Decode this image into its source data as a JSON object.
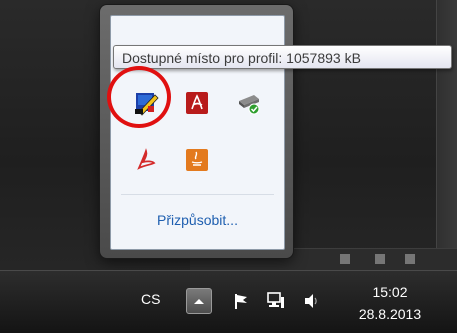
{
  "tooltip": {
    "text": "Dostupné místo pro profil:  1057893 kB"
  },
  "tray_popup": {
    "icons": [
      "drawing-tool-icon",
      "adobe-acrobat-icon",
      "network-drive-icon",
      "acrobat-reader-icon",
      "java-update-icon"
    ],
    "customize_label": "Přizpůsobit..."
  },
  "taskbar": {
    "language": "CS",
    "tray_icons": [
      "show-hidden-icons-icon",
      "action-center-flag-icon",
      "network-icon",
      "volume-icon"
    ],
    "clock": {
      "time": "15:02",
      "date": "28.8.2013"
    }
  },
  "colors": {
    "highlight": "#e01010",
    "link": "#1f5fb0"
  }
}
